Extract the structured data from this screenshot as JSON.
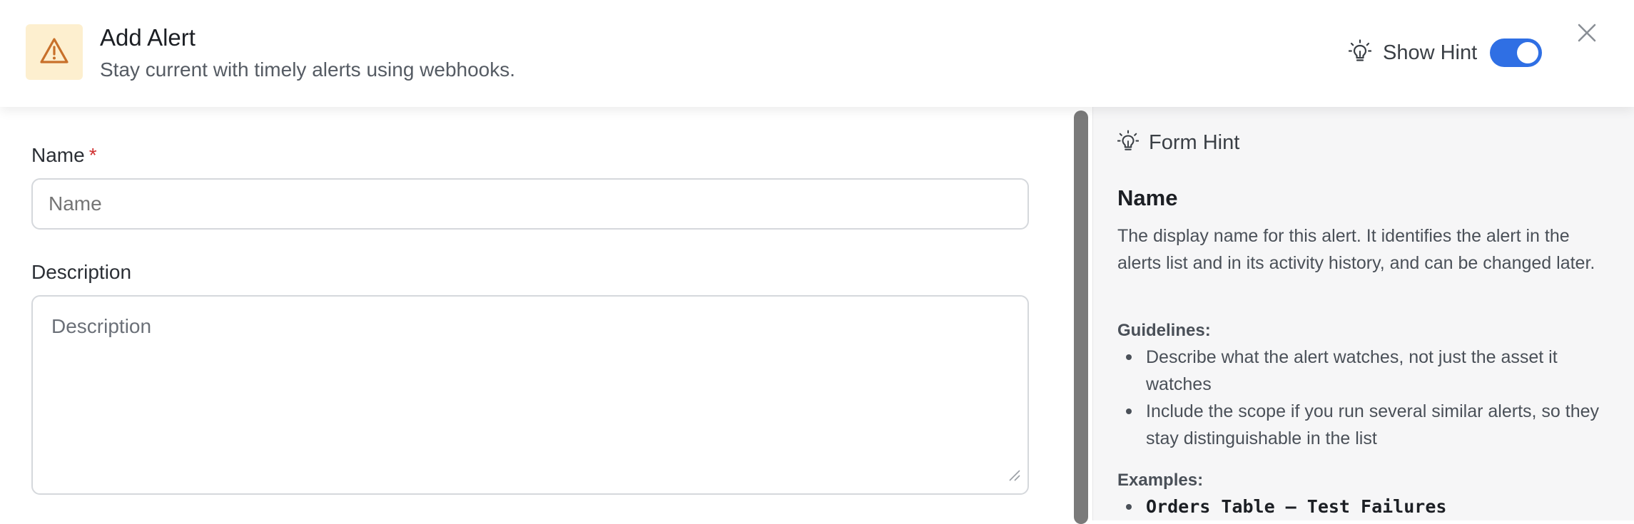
{
  "header": {
    "icon": "warning-triangle-icon",
    "title": "Add Alert",
    "subtitle": "Stay current with timely alerts using webhooks.",
    "hint_toggle": {
      "label": "Show Hint",
      "icon": "lightbulb-icon",
      "on": true
    },
    "close_icon": "close-icon"
  },
  "form": {
    "name": {
      "label": "Name",
      "required_marker": "*",
      "placeholder": "Name",
      "value": ""
    },
    "description": {
      "label": "Description",
      "placeholder": "Description",
      "value": ""
    }
  },
  "hint_panel": {
    "title": "Form Hint",
    "icon": "lightbulb-icon",
    "heading": "Name",
    "body": "The display name for this alert. It identifies the alert in the alerts list and in its activity history, and can be changed later.",
    "guidelines_label": "Guidelines:",
    "guidelines": [
      "Describe what the alert watches, not just the asset it watches",
      "Include the scope if you run several similar alerts, so they stay distinguishable in the list"
    ],
    "examples_label": "Examples:",
    "examples": [
      "Orders Table – Test Failures"
    ]
  },
  "colors": {
    "accent": "#2f6fe4",
    "warning_bg": "#fdefcf",
    "warning_icon": "#c8702a",
    "required": "#d03030"
  }
}
